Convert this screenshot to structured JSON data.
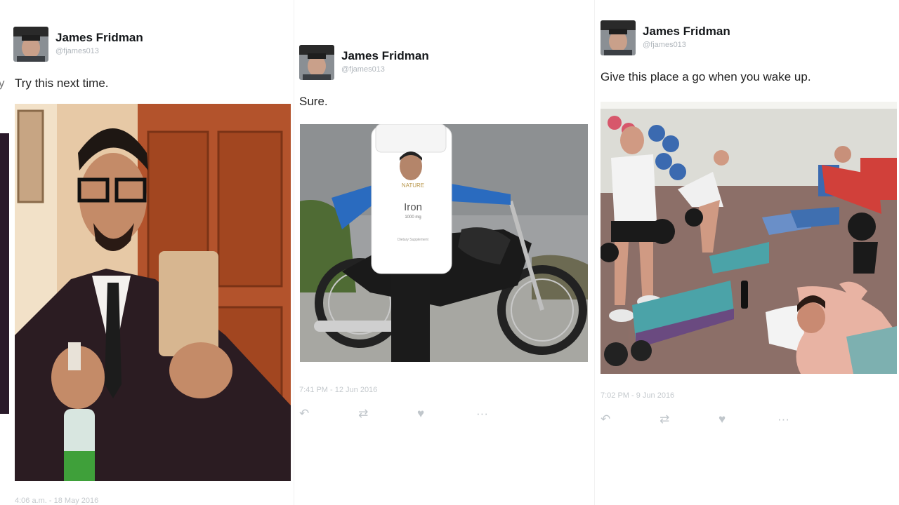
{
  "tweets": [
    {
      "author": "James Fridman",
      "handle": "@fjames013",
      "text": "Try this next time.",
      "timestamp": "4:06 a.m. - 18 May 2016"
    },
    {
      "author": "James Fridman",
      "handle": "@fjames013",
      "text": "Sure.",
      "timestamp": "7:41 PM - 12 Jun 2016",
      "bottle": {
        "brand": "NATURE",
        "label": "Iron",
        "dose": "1000 mg",
        "sub": "Dietary Supplement"
      }
    },
    {
      "author": "James Fridman",
      "handle": "@fjames013",
      "text": "Give this place a go when you wake up.",
      "timestamp": "7:02 PM - 9 Jun 2016"
    }
  ],
  "icons": {
    "reply": "reply-icon",
    "retweet": "retweet-icon",
    "like": "heart-icon",
    "more": "more-icon"
  },
  "colors": {
    "name": "#14171a",
    "meta": "#c4c9cd",
    "action": "#c0c6cb"
  }
}
